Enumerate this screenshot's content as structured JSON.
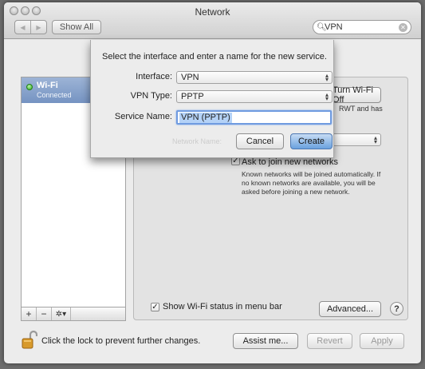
{
  "window": {
    "title": "Network"
  },
  "toolbar": {
    "show_all": "Show All",
    "search_value": "VPN"
  },
  "services": [
    {
      "name": "Wi-Fi",
      "status": "Connected"
    }
  ],
  "sidebar_tools": {
    "add": "+",
    "remove": "−",
    "gear": "✲▾"
  },
  "panel": {
    "wifi_off_button": "Turn Wi-Fi Off",
    "status_text_fragment": "RWT and has",
    "network_name_label": "Network Name:",
    "ask_to_join_label": "Ask to join new networks",
    "ask_to_join_checked": true,
    "ask_to_join_desc": "Known networks will be joined automatically. If no known networks are available, you will be asked before joining a new network.",
    "show_in_menu_bar_label": "Show Wi-Fi status in menu bar",
    "show_in_menu_bar_checked": true,
    "advanced_button": "Advanced...",
    "help_button": "?"
  },
  "footer": {
    "lock_label": "Click the lock to prevent further changes.",
    "assist_button": "Assist me...",
    "revert_button": "Revert",
    "apply_button": "Apply"
  },
  "sheet": {
    "prompt": "Select the interface and enter a name for the new service.",
    "interface_label": "Interface:",
    "interface_value": "VPN",
    "vpn_type_label": "VPN Type:",
    "vpn_type_value": "PPTP",
    "service_name_label": "Service Name:",
    "service_name_value": "VPN (PPTP)",
    "cancel_button": "Cancel",
    "create_button": "Create"
  },
  "colors": {
    "selection": "#7593c2",
    "default_button": "#6aa1de",
    "connected": "#2fa51f"
  }
}
